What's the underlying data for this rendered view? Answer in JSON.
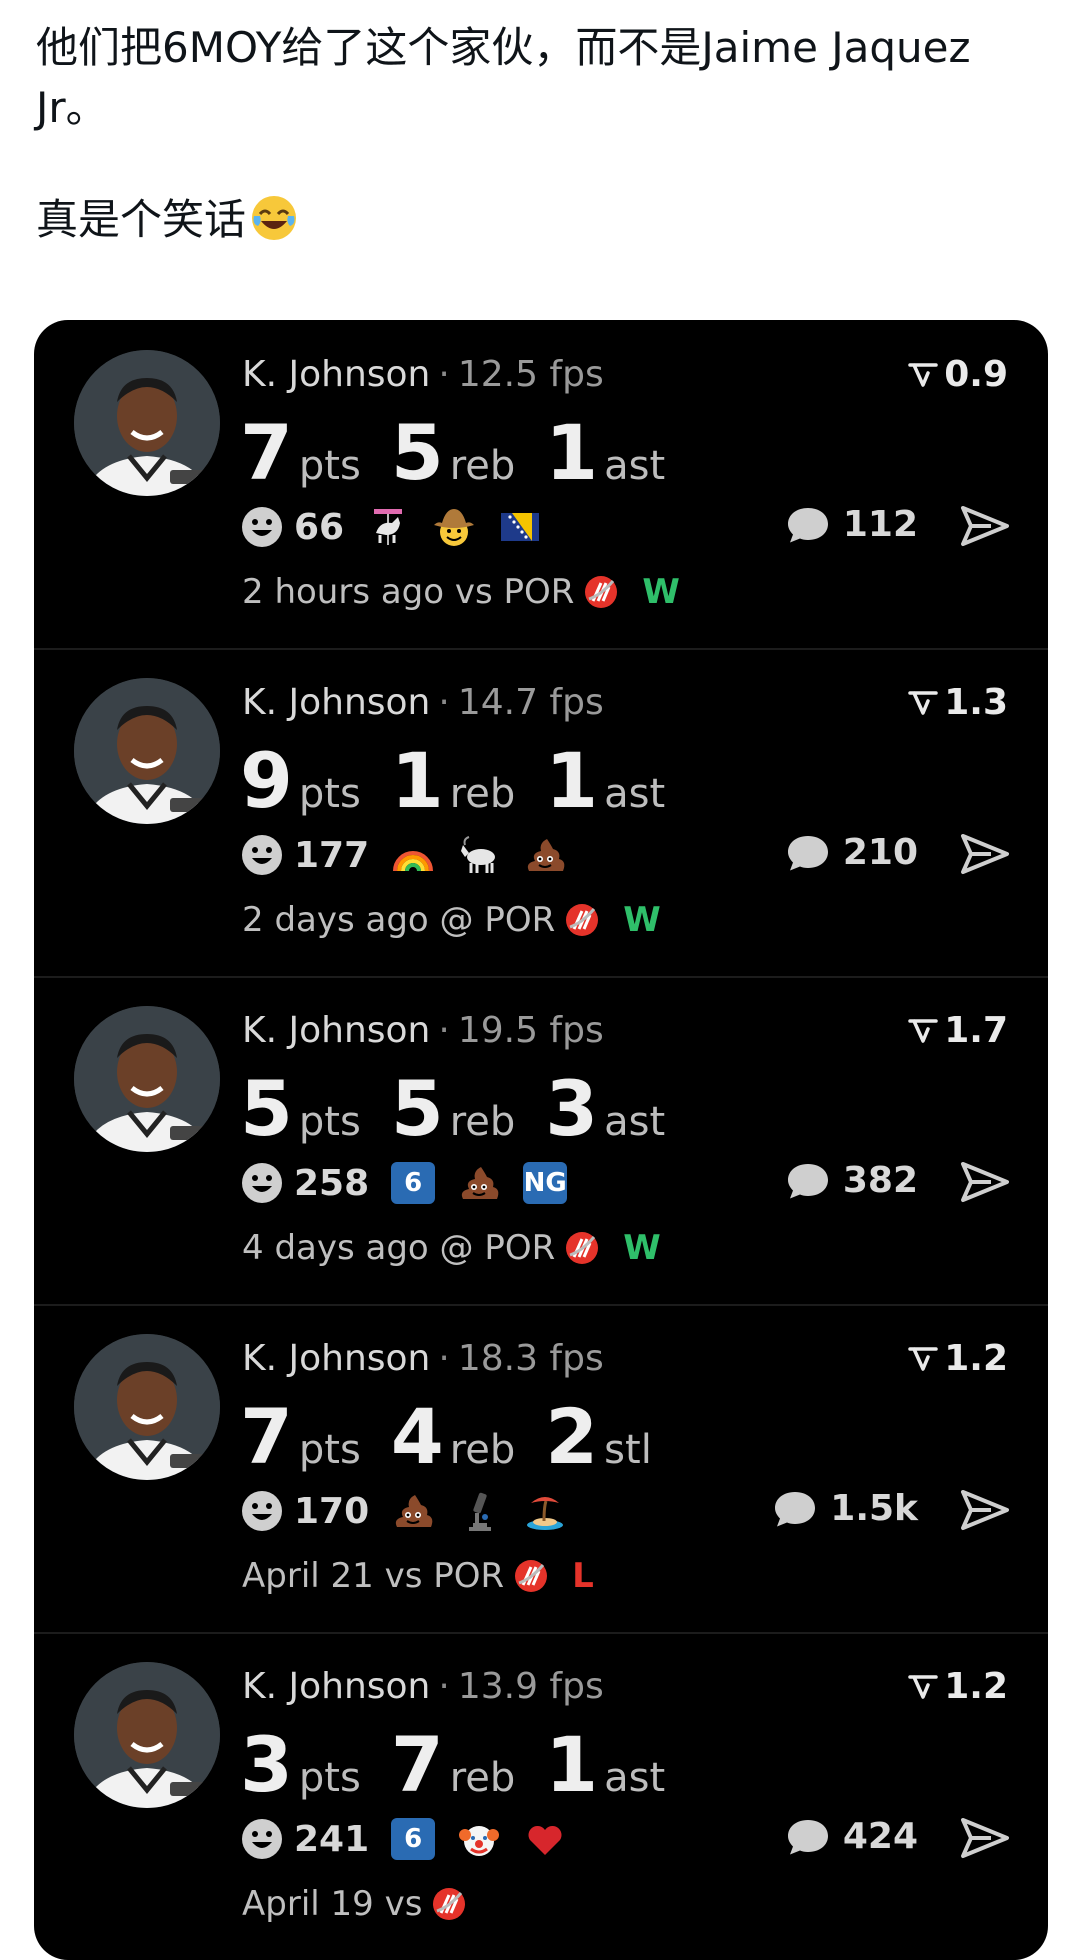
{
  "post": {
    "line1": "他们把6MOY给了这个家伙，而不是Jaime Jaquez Jr。",
    "line2": "真是个笑话",
    "line2_emoji": "face-with-tears-of-joy"
  },
  "colors": {
    "card_bg": "#000000",
    "win": "#2fbf6a",
    "loss": "#e5332a",
    "badge": "#2a6bb3"
  },
  "rows": [
    {
      "name": "K. Johnson",
      "fps": "12.5 fps",
      "delta": "0.9",
      "stats": [
        {
          "n": "7",
          "u": "pts"
        },
        {
          "n": "5",
          "u": "reb"
        },
        {
          "n": "1",
          "u": "ast"
        }
      ],
      "reactions_count": "66",
      "emojis": [
        "carousel-horse-icon",
        "cowboy-face-icon",
        "bosnia-flag-icon"
      ],
      "comments": "112",
      "time": "2 hours ago",
      "vs": "vs POR",
      "result": "W"
    },
    {
      "name": "K. Johnson",
      "fps": "14.7 fps",
      "delta": "1.3",
      "stats": [
        {
          "n": "9",
          "u": "pts"
        },
        {
          "n": "1",
          "u": "reb"
        },
        {
          "n": "1",
          "u": "ast"
        }
      ],
      "reactions_count": "177",
      "emojis": [
        "rainbow-icon",
        "goat-icon",
        "poop-icon"
      ],
      "comments": "210",
      "time": "2 days ago",
      "vs": "@ POR",
      "result": "W"
    },
    {
      "name": "K. Johnson",
      "fps": "19.5 fps",
      "delta": "1.7",
      "stats": [
        {
          "n": "5",
          "u": "pts"
        },
        {
          "n": "5",
          "u": "reb"
        },
        {
          "n": "3",
          "u": "ast"
        }
      ],
      "reactions_count": "258",
      "emojis": [
        "badge-6",
        "poop-icon",
        "badge-NG"
      ],
      "badges": {
        "six": "6",
        "ng": "NG"
      },
      "comments": "382",
      "time": "4 days ago",
      "vs": "@ POR",
      "result": "W"
    },
    {
      "name": "K. Johnson",
      "fps": "18.3 fps",
      "delta": "1.2",
      "stats": [
        {
          "n": "7",
          "u": "pts"
        },
        {
          "n": "4",
          "u": "reb"
        },
        {
          "n": "2",
          "u": "stl"
        }
      ],
      "reactions_count": "170",
      "emojis": [
        "poop-icon",
        "microscope-icon",
        "desert-island-icon"
      ],
      "comments": "1.5k",
      "time": "April 21",
      "vs": "vs POR",
      "result": "L"
    },
    {
      "name": "K. Johnson",
      "fps": "13.9 fps",
      "delta": "1.2",
      "stats": [
        {
          "n": "3",
          "u": "pts"
        },
        {
          "n": "7",
          "u": "reb"
        },
        {
          "n": "1",
          "u": "ast"
        }
      ],
      "reactions_count": "241",
      "emojis": [
        "badge-6",
        "clown-face-icon",
        "red-heart-icon"
      ],
      "badges": {
        "six": "6"
      },
      "comments": "424",
      "time": "April 19",
      "vs": "vs",
      "result": ""
    }
  ]
}
